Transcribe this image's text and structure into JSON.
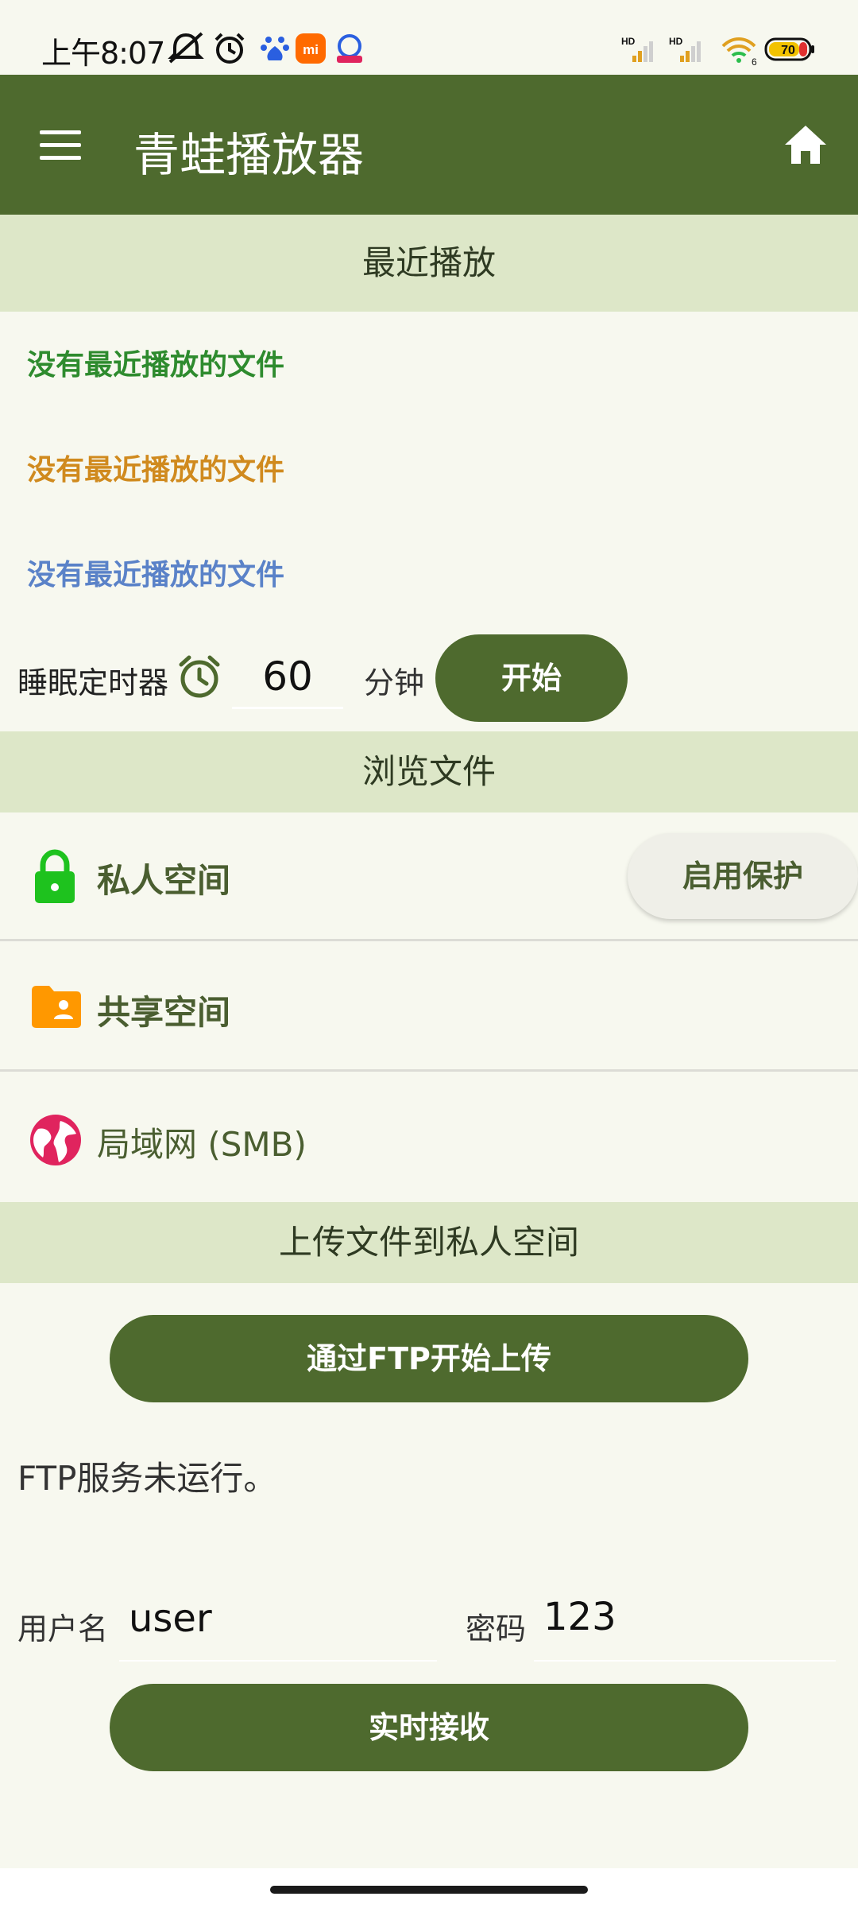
{
  "status_bar": {
    "time": "上午8:07",
    "battery": "70",
    "icons": [
      "mute-icon",
      "alarm-icon",
      "baidu-icon",
      "mi-icon",
      "baidu-netdisk-icon",
      "hd-signal-icon",
      "hd-signal-icon",
      "wifi-icon",
      "battery-icon"
    ]
  },
  "app_bar": {
    "title": "青蛙播放器",
    "menu_icon": "menu-icon",
    "home_icon": "home-icon"
  },
  "recent": {
    "header": "最近播放",
    "items": [
      {
        "label": "没有最近播放的文件",
        "color": "#2e8b2e"
      },
      {
        "label": "没有最近播放的文件",
        "color": "#d08a1e"
      },
      {
        "label": "没有最近播放的文件",
        "color": "#5a82c8"
      }
    ]
  },
  "sleep_timer": {
    "label": "睡眠定时器",
    "minutes": "60",
    "unit": "分钟",
    "start_label": "开始"
  },
  "browse": {
    "header": "浏览文件",
    "items": [
      {
        "label": "私人空间",
        "icon": "lock-icon",
        "icon_color": "#1ec21e"
      },
      {
        "label": "共享空间",
        "icon": "shared-folder-icon",
        "icon_color": "#ff9800"
      },
      {
        "label": "局域网 (SMB)",
        "icon": "globe-icon",
        "icon_color": "#e0245e"
      }
    ],
    "protect_label": "启用保护"
  },
  "upload": {
    "header": "上传文件到私人空间",
    "ftp_button": "通过FTP开始上传",
    "ftp_status": "FTP服务未运行。",
    "username_label": "用户名",
    "username": "user",
    "password_label": "密码",
    "password": "123",
    "receive_button": "实时接收"
  },
  "colors": {
    "primary": "#4e6a2e",
    "section_bg": "#dde7c8",
    "background": "#f7f8ef"
  }
}
